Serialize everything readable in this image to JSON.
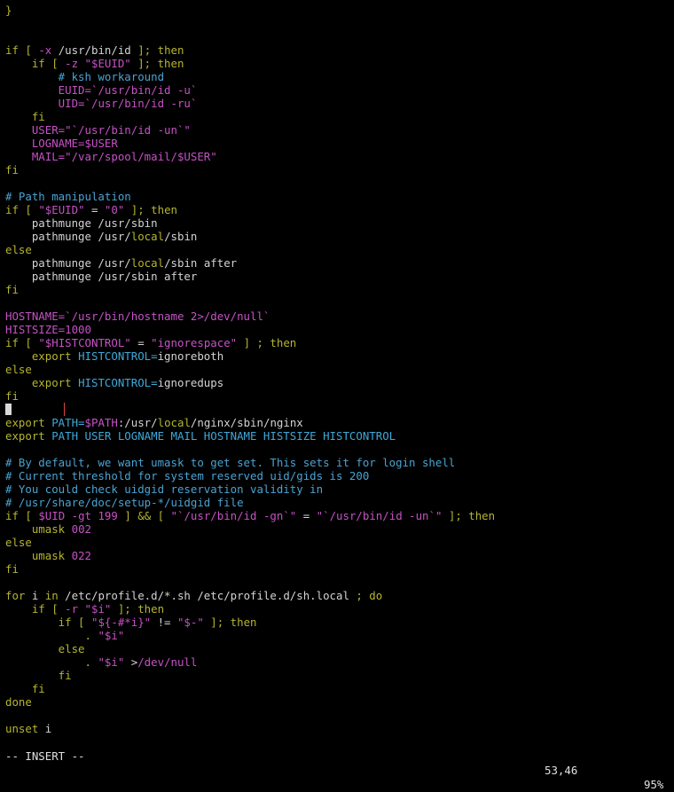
{
  "editor": {
    "mode": "-- INSERT --",
    "position": "53,46",
    "percent": "95%",
    "colors": {
      "background": "#000000",
      "text": "#d3d3d3",
      "keyword": "#b5b52f",
      "string": "#c552c5",
      "comment": "#4aa3d4",
      "variable": "#c552c5",
      "builtin": "#3fa9d9",
      "highlight_border": "#e0443f"
    },
    "highlighted_line": 30,
    "lines": [
      [
        [
          "}",
          "kw"
        ]
      ],
      [],
      [],
      [
        [
          "if [ ",
          "kw"
        ],
        [
          "-x ",
          "s"
        ],
        [
          "/usr/bin/id ",
          "t"
        ],
        [
          "]; then",
          "kw"
        ]
      ],
      [
        [
          "    if [ ",
          "kw"
        ],
        [
          "-z ",
          "s"
        ],
        [
          "\"$EUID\"",
          "s"
        ],
        [
          " ]; then",
          "kw"
        ]
      ],
      [
        [
          "        # ksh workaround",
          "c"
        ]
      ],
      [
        [
          "        EUID=",
          "v"
        ],
        [
          "`/usr/bin/id -u`",
          "s"
        ]
      ],
      [
        [
          "        UID=",
          "v"
        ],
        [
          "`/usr/bin/id -ru`",
          "s"
        ]
      ],
      [
        [
          "    fi",
          "kw"
        ]
      ],
      [
        [
          "    USER=",
          "v"
        ],
        [
          "\"`/usr/bin/id -un`\"",
          "s"
        ]
      ],
      [
        [
          "    LOGNAME=",
          "v"
        ],
        [
          "$USER",
          "s"
        ]
      ],
      [
        [
          "    MAIL=",
          "v"
        ],
        [
          "\"/var/spool/mail/$USER\"",
          "s"
        ]
      ],
      [
        [
          "fi",
          "kw"
        ]
      ],
      [],
      [
        [
          "# Path manipulation",
          "c"
        ]
      ],
      [
        [
          "if [ ",
          "kw"
        ],
        [
          "\"$EUID\"",
          "s"
        ],
        [
          " = ",
          "t"
        ],
        [
          "\"0\"",
          "s"
        ],
        [
          " ]; then",
          "kw"
        ]
      ],
      [
        [
          "    pathmunge /usr/sbin",
          "t"
        ]
      ],
      [
        [
          "    pathmunge /usr/",
          "t"
        ],
        [
          "local",
          "kw"
        ],
        [
          "/sbin",
          "t"
        ]
      ],
      [
        [
          "else",
          "kw"
        ]
      ],
      [
        [
          "    pathmunge /usr/",
          "t"
        ],
        [
          "local",
          "kw"
        ],
        [
          "/sbin after",
          "t"
        ]
      ],
      [
        [
          "    pathmunge /usr/sbin after",
          "t"
        ]
      ],
      [
        [
          "fi",
          "kw"
        ]
      ],
      [],
      [
        [
          "HOSTNAME=",
          "v"
        ],
        [
          "`/usr/bin/hostname 2>/dev/null`",
          "s"
        ]
      ],
      [
        [
          "HISTSIZE=",
          "v"
        ],
        [
          "1000",
          "s"
        ]
      ],
      [
        [
          "if [ ",
          "kw"
        ],
        [
          "\"$HISTCONTROL\"",
          "s"
        ],
        [
          " = ",
          "t"
        ],
        [
          "\"ignorespace\"",
          "s"
        ],
        [
          " ] ; then",
          "kw"
        ]
      ],
      [
        [
          "    export ",
          "kw"
        ],
        [
          "HISTCONTROL=",
          "b"
        ],
        [
          "ignoreboth",
          "t"
        ]
      ],
      [
        [
          "else",
          "kw"
        ]
      ],
      [
        [
          "    export ",
          "kw"
        ],
        [
          "HISTCONTROL=",
          "b"
        ],
        [
          "ignoredups",
          "t"
        ]
      ],
      [
        [
          "fi",
          "kw"
        ]
      ],
      [],
      [
        [
          "export ",
          "kw"
        ],
        [
          "PATH=",
          "b"
        ],
        [
          "$PATH",
          "s"
        ],
        [
          ":/usr/",
          "t"
        ],
        [
          "local",
          "kw"
        ],
        [
          "/nginx/sbin/nginx",
          "t"
        ]
      ],
      [
        [
          "export ",
          "kw"
        ],
        [
          "PATH USER LOGNAME MAIL HOSTNAME HISTSIZE HISTCONTROL",
          "b"
        ]
      ],
      [],
      [
        [
          "# By default, we want umask to get set. This sets it for login shell",
          "c"
        ]
      ],
      [
        [
          "# Current threshold for system reserved uid/gids is 200",
          "c"
        ]
      ],
      [
        [
          "# You could check uidgid reservation validity in",
          "c"
        ]
      ],
      [
        [
          "# /usr/share/doc/setup-*/uidgid file",
          "c"
        ]
      ],
      [
        [
          "if [ ",
          "kw"
        ],
        [
          "$UID ",
          "s"
        ],
        [
          "-gt 199 ",
          "s"
        ],
        [
          "] && [ ",
          "kw"
        ],
        [
          "\"`/usr/bin/id -gn`\"",
          "s"
        ],
        [
          " = ",
          "t"
        ],
        [
          "\"`/usr/bin/id -un`\"",
          "s"
        ],
        [
          " ]; then",
          "kw"
        ]
      ],
      [
        [
          "    umask ",
          "kw"
        ],
        [
          "002",
          "s"
        ]
      ],
      [
        [
          "else",
          "kw"
        ]
      ],
      [
        [
          "    umask ",
          "kw"
        ],
        [
          "022",
          "s"
        ]
      ],
      [
        [
          "fi",
          "kw"
        ]
      ],
      [],
      [
        [
          "for ",
          "kw"
        ],
        [
          "i ",
          "t"
        ],
        [
          "in ",
          "kw"
        ],
        [
          "/etc/profile.d/*.sh /etc/profile.d/sh.local ",
          "t"
        ],
        [
          "; do",
          "kw"
        ]
      ],
      [
        [
          "    if [ ",
          "kw"
        ],
        [
          "-r ",
          "s"
        ],
        [
          "\"$i\"",
          "s"
        ],
        [
          " ]; then",
          "kw"
        ]
      ],
      [
        [
          "        if [ ",
          "kw"
        ],
        [
          "\"${-#*i}\"",
          "s"
        ],
        [
          " != ",
          "t"
        ],
        [
          "\"$-\"",
          "s"
        ],
        [
          " ]; then",
          "kw"
        ]
      ],
      [
        [
          "            . ",
          "kw"
        ],
        [
          "\"$i\"",
          "s"
        ]
      ],
      [
        [
          "        else",
          "kw"
        ]
      ],
      [
        [
          "            . ",
          "kw"
        ],
        [
          "\"$i\"",
          "s"
        ],
        [
          " >",
          "t"
        ],
        [
          "/dev/null",
          "s"
        ]
      ],
      [
        [
          "        fi",
          "kw"
        ]
      ],
      [
        [
          "    fi",
          "kw"
        ]
      ],
      [
        [
          "done",
          "kw"
        ]
      ],
      [],
      [
        [
          "unset ",
          "kw"
        ],
        [
          "i",
          "t"
        ]
      ]
    ]
  }
}
